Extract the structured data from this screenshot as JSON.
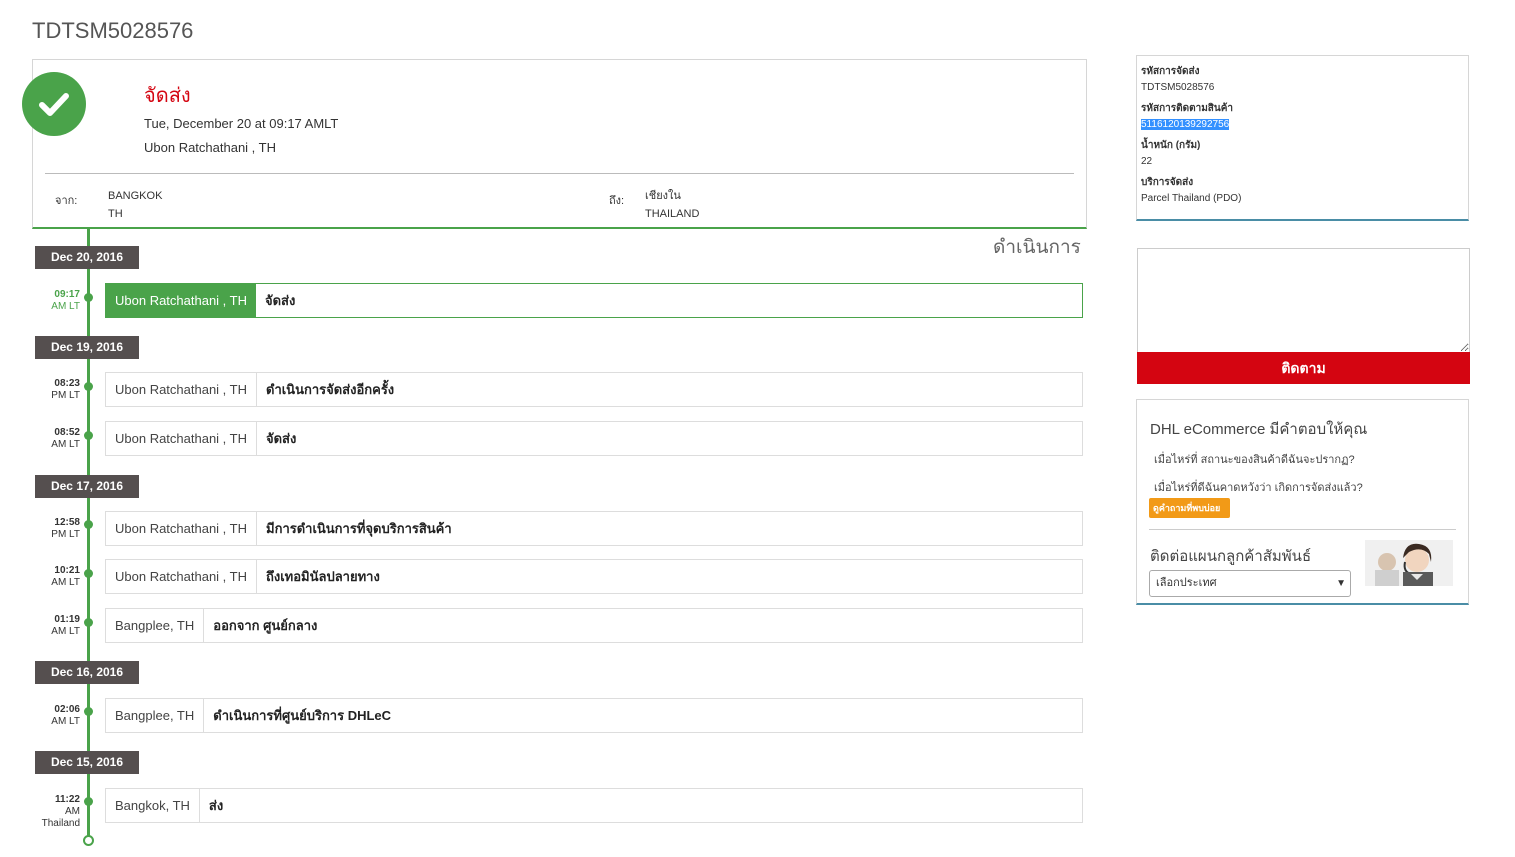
{
  "page": {
    "title": "TDTSM5028576"
  },
  "status": {
    "title": "จัดส่ง",
    "datetime": "Tue, December 20 at 09:17 AMLT",
    "location": "Ubon Ratchathani , TH",
    "from_label": "จาก:",
    "from_city": "BANGKOK",
    "from_country": "TH",
    "to_label": "ถึง:",
    "to_city": "เชียงใน",
    "to_country": "THAILAND"
  },
  "progress_label": "ดำเนินการ",
  "timeline": {
    "dates": [
      "Dec 20, 2016",
      "Dec 19, 2016",
      "Dec 17, 2016",
      "Dec 16, 2016",
      "Dec 15, 2016"
    ],
    "events": [
      {
        "time": "09:17",
        "suffix": "AM LT",
        "location": "Ubon Ratchathani , TH",
        "description": "จัดส่ง"
      },
      {
        "time": "08:23",
        "suffix": "PM LT",
        "location": "Ubon Ratchathani , TH",
        "description": "ดำเนินการจัดส่งอีกครั้ง"
      },
      {
        "time": "08:52",
        "suffix": "AM LT",
        "location": "Ubon Ratchathani , TH",
        "description": "จัดส่ง"
      },
      {
        "time": "12:58",
        "suffix": "PM LT",
        "location": "Ubon Ratchathani , TH",
        "description": "มีการดำเนินการที่จุดบริการสินค้า"
      },
      {
        "time": "10:21",
        "suffix": "AM LT",
        "location": "Ubon Ratchathani , TH",
        "description": "ถึงเทอมินัลปลายทาง"
      },
      {
        "time": "01:19",
        "suffix": "AM LT",
        "location": "Bangplee, TH",
        "description": "ออกจาก ศูนย์กลาง"
      },
      {
        "time": "02:06",
        "suffix": "AM LT",
        "location": "Bangplee, TH",
        "description": "ดำเนินการที่ศูนย์บริการ DHLeC"
      },
      {
        "time": "11:22",
        "suffix": "AM",
        "suffix2": "Thailand",
        "location": "Bangkok, TH",
        "description": "ส่ง"
      }
    ]
  },
  "info": {
    "shipment_id_label": "รหัสการจัดส่ง",
    "shipment_id": "TDTSM5028576",
    "tracking_label": "รหัสการติดตามสินค้า",
    "tracking_number": "5116120139292756",
    "weight_label": "น้ำหนัก (กรัม)",
    "weight": "22",
    "service_label": "บริการจัดส่ง",
    "service": "Parcel Thailand (PDO)"
  },
  "track": {
    "button_label": "ติดตาม",
    "textarea_value": ""
  },
  "help": {
    "title": "DHL eCommerce มีคำตอบให้คุณ",
    "q1": "เมื่อไหร่ที่ สถานะของสินค้าดีฉันจะปรากฏ?",
    "q2": "เมื่อไหร่ที่ดีฉันคาดหวังว่า เกิดการจัดส่งแล้ว?",
    "faq_button": "ดูคำถามที่พบบ่อย",
    "contact_title": "ติดต่อแผนกลูกค้าสัมพันธ์",
    "country_select": "เลือกประเทศ"
  },
  "colors": {
    "success": "#4aa34a",
    "brand_red": "#d40511",
    "badge": "#554f4f",
    "accent_orange": "#f29a17"
  }
}
